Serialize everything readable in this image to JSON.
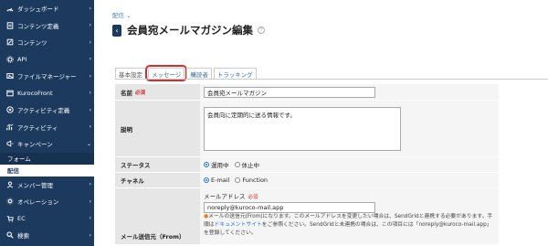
{
  "sidebar": {
    "items": [
      {
        "label": "ダッシュボード",
        "icon": "dashboard-icon"
      },
      {
        "label": "コンテンツ定義",
        "icon": "content-definition-icon"
      },
      {
        "label": "コンテンツ",
        "icon": "content-icon"
      },
      {
        "label": "API",
        "icon": "api-icon"
      },
      {
        "label": "ファイルマネージャー",
        "icon": "file-manager-icon"
      },
      {
        "label": "KurocoFront",
        "icon": "kurocofront-icon"
      },
      {
        "label": "アクティビティ定義",
        "icon": "activity-definition-icon"
      },
      {
        "label": "アクティビティ",
        "icon": "activity-icon"
      },
      {
        "label": "キャンペーン",
        "icon": "campaign-icon"
      }
    ],
    "campaign_sub": [
      "フォーム",
      "配信"
    ],
    "items_bottom": [
      {
        "label": "メンバー管理",
        "icon": "member-icon"
      },
      {
        "label": "オペレーション",
        "icon": "operation-icon"
      },
      {
        "label": "EC",
        "icon": "ec-icon"
      },
      {
        "label": "検索",
        "icon": "search-icon"
      }
    ]
  },
  "breadcrumb": "配信",
  "page_title": "会員宛メールマガジン編集",
  "tabs": [
    "基本設定",
    "メッセージ",
    "購読者",
    "トラッキング"
  ],
  "form": {
    "name_label": "名前",
    "required_text": "必須",
    "name_value": "会員宛メールマガジン",
    "desc_label": "説明",
    "desc_value": "会員向に定期的に送る情報です。",
    "status_label": "ステータス",
    "status_opt1": "運用中",
    "status_opt2": "休止中",
    "channel_label": "チャネル",
    "channel_opt1": "E-mail",
    "channel_opt2": "Function",
    "from_label": "メール送信元（From）",
    "from_sub_label": "メールアドレス",
    "from_value": "noreply@kuroco-mail.app",
    "note_a": "メールの送信元(From)になります。このメールアドレスを変更したい場合は、SendGridと連携する必要があります。手順は",
    "note_link": "ドキュメントサイト",
    "note_b": "をご参照ください。SendGridと未連携の場合は、この項目には「noreply@kuroco-mail.app」を登録してください。"
  },
  "colors": {
    "sidebar_bg": "#1c3a5e",
    "highlight": "#d32f2f",
    "link": "#1a73e8"
  }
}
